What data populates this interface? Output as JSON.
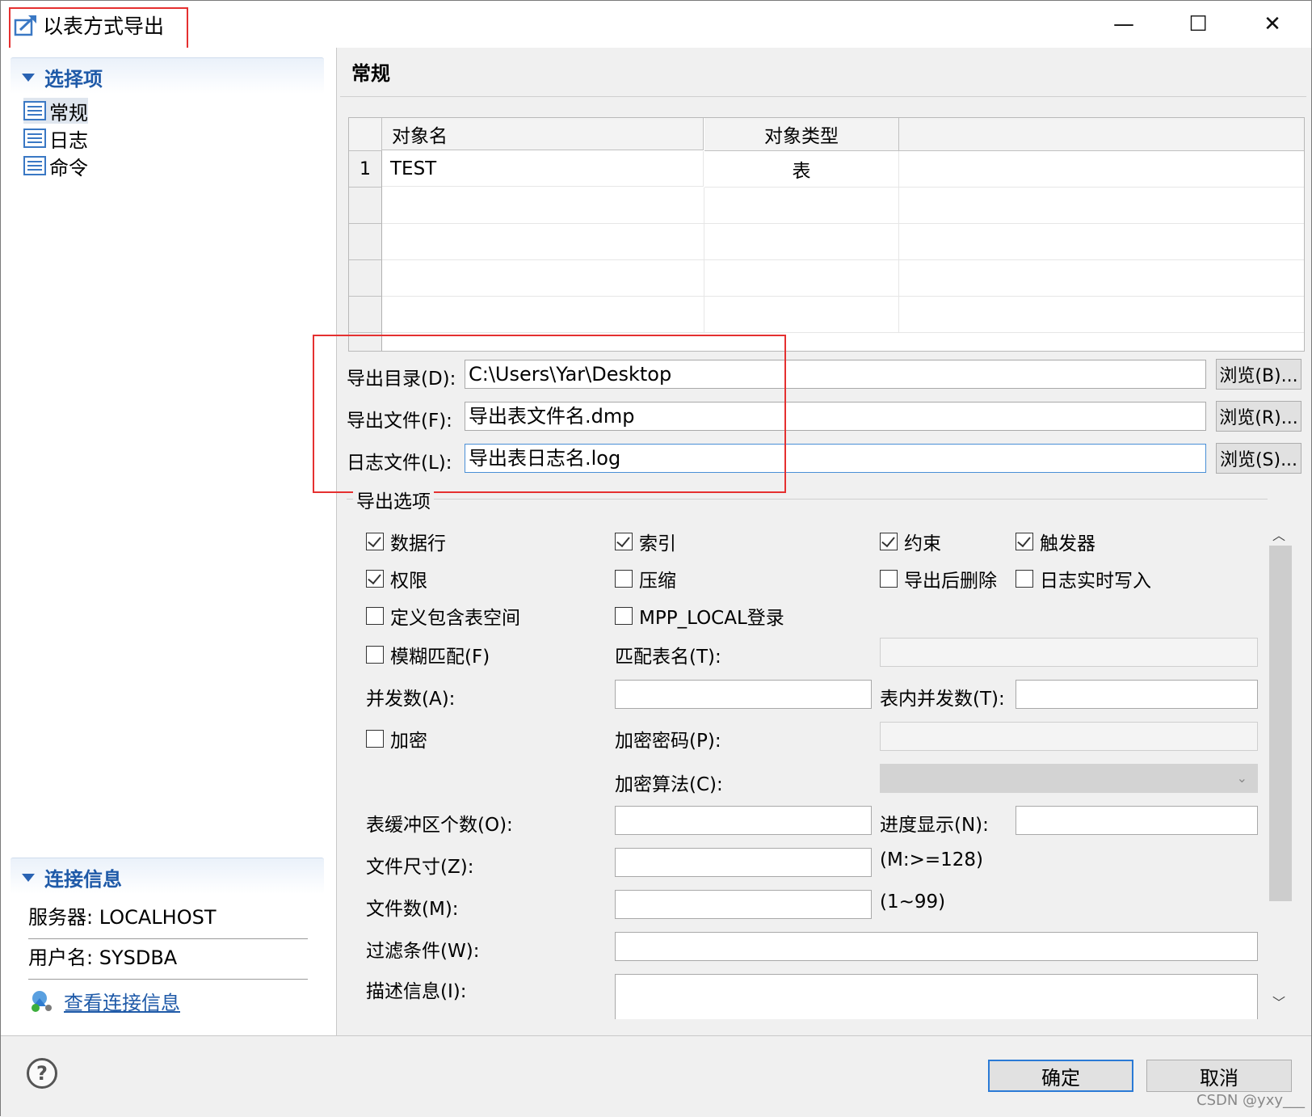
{
  "window": {
    "title": "以表方式导出",
    "minimize_glyph": "—",
    "maximize_glyph": "☐",
    "close_glyph": "✕"
  },
  "left": {
    "options_header": "选择项",
    "tree": [
      {
        "label": "常规",
        "selected": true
      },
      {
        "label": "日志",
        "selected": false
      },
      {
        "label": "命令",
        "selected": false
      }
    ],
    "connection_header": "连接信息",
    "server": "服务器: LOCALHOST",
    "user": "用户名: SYSDBA",
    "view_link": "查看连接信息"
  },
  "main": {
    "section_title": "常规",
    "table": {
      "columns": [
        "对象名",
        "对象类型"
      ],
      "rows": [
        {
          "num": "1",
          "name": "TEST",
          "type": "表"
        }
      ]
    },
    "export_dir_label": "导出目录(D):",
    "export_dir_value": "C:\\Users\\Yar\\Desktop",
    "browse_b": "浏览(B)...",
    "export_file_label": "导出文件(F):",
    "export_file_value": "导出表文件名.dmp",
    "browse_r": "浏览(R)...",
    "log_file_label": "日志文件(L):",
    "log_file_value": "导出表日志名.log",
    "browse_s": "浏览(S)..."
  },
  "options": {
    "legend": "导出选项",
    "checkboxes": {
      "data_rows": {
        "label": "数据行",
        "checked": true
      },
      "index": {
        "label": "索引",
        "checked": true
      },
      "constraint": {
        "label": "约束",
        "checked": true
      },
      "trigger": {
        "label": "触发器",
        "checked": true
      },
      "privilege": {
        "label": "权限",
        "checked": true
      },
      "compress": {
        "label": "压缩",
        "checked": false
      },
      "delete_after": {
        "label": "导出后删除",
        "checked": false
      },
      "log_realtime": {
        "label": "日志实时写入",
        "checked": false
      },
      "tablespace": {
        "label": "定义包含表空间",
        "checked": false
      },
      "mpp_local": {
        "label": "MPP_LOCAL登录",
        "checked": false
      },
      "fuzzy": {
        "label": "模糊匹配(F)",
        "checked": false
      },
      "encrypt": {
        "label": "加密",
        "checked": false
      }
    },
    "match_table_label": "匹配表名(T):",
    "parallel_label": "并发数(A):",
    "table_parallel_label": "表内并发数(T):",
    "encrypt_pwd_label": "加密密码(P):",
    "encrypt_algo_label": "加密算法(C):",
    "buffer_label": "表缓冲区个数(O):",
    "progress_label": "进度显示(N):",
    "file_size_label": "文件尺寸(Z):",
    "file_size_hint": "(M:>=128)",
    "file_count_label": "文件数(M):",
    "file_count_hint": "(1~99)",
    "filter_label": "过滤条件(W):",
    "desc_label": "描述信息(I):"
  },
  "footer": {
    "help_glyph": "?",
    "ok": "确定",
    "cancel": "取消",
    "watermark": "CSDN @yxy___"
  }
}
